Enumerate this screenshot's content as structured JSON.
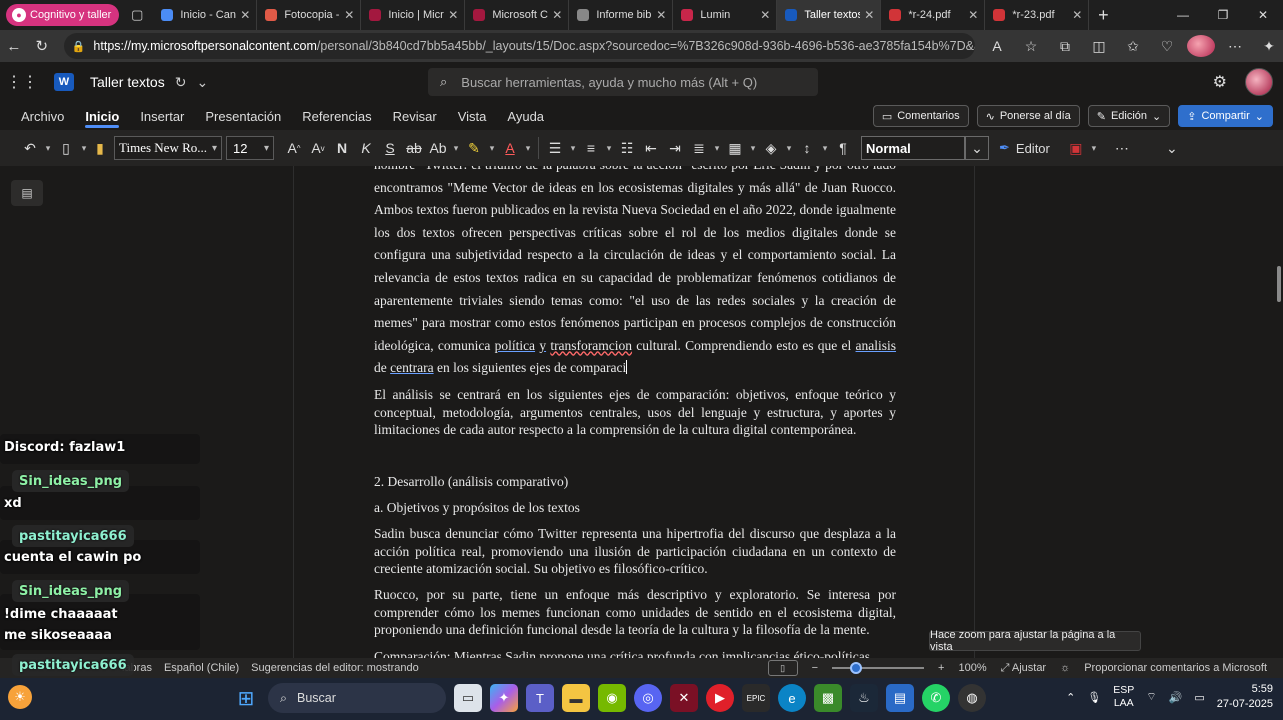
{
  "browser": {
    "profile_label": "Cognitivo y taller",
    "tabs": [
      {
        "title": "Inicio - Canv",
        "color": "#4b8cf5"
      },
      {
        "title": "Fotocopia -",
        "color": "#e05a47"
      },
      {
        "title": "Inicio | Micr",
        "color": "#a3183f"
      },
      {
        "title": "Microsoft C",
        "color": "#a3183f"
      },
      {
        "title": "Informe bibl",
        "color": "#888888"
      },
      {
        "title": "Lumin",
        "color": "#c8264a"
      },
      {
        "title": "Taller textos",
        "color": "#185abd"
      },
      {
        "title": "*r-24.pdf",
        "color": "#d13438"
      },
      {
        "title": "*r-23.pdf",
        "color": "#d13438"
      }
    ],
    "url_host": "https://my.microsoftpersonalcontent.com",
    "url_path": "/personal/3b840cd7bb5a45bb/_layouts/15/Doc.aspx?sourcedoc=%7B326c908d-936b-4696-b536-ae3785fa154b%7D&action=default"
  },
  "word": {
    "doc_title": "Taller textos",
    "search_placeholder": "Buscar herramientas, ayuda y mucho más (Alt + Q)",
    "ribbon_tabs": [
      "Archivo",
      "Inicio",
      "Insertar",
      "Presentación",
      "Referencias",
      "Revisar",
      "Vista",
      "Ayuda"
    ],
    "buttons": {
      "comments": "Comentarios",
      "catchup": "Ponerse al día",
      "editing": "Edición",
      "share": "Compartir"
    },
    "toolbar": {
      "font": "Times New Ro...",
      "size": "12",
      "style": "Normal",
      "editor": "Editor"
    }
  },
  "document": {
    "p1_a": "hombre \"Twitter: el triunfo de la palabra sobre la acción\" escrito por Eric Sadin y por otro lado encontramos \"Meme Vector de ideas en los ecosistemas digitales y más allá\" de Juan Ruocco. Ambos textos fueron publicados en la revista Nueva Sociedad en el año 2022, donde igualmente los dos textos ofrecen perspectivas críticas sobre el rol de los medios digitales donde se configura una subjetividad respecto a la circulación de ideas y el comportamiento social. La relevancia de estos textos radica en su capacidad de problematizar fenómenos cotidianos de aparentemente triviales siendo temas como: \"el uso de las redes sociales y la creación de memes\" para mostrar como estos fenómenos participan en procesos complejos de construcción ideológica, comunica ",
    "p1_u1": "política",
    "p1_sp": " ",
    "p1_u2": "y",
    "p1_sp2": " ",
    "p1_u3": "transforamcion",
    "p1_b": " cultural. Comprendiendo esto es que el ",
    "p1_u4": "analisis",
    "p1_c": " de ",
    "p1_u5": "centrara",
    "p1_d": " en los siguientes ejes de comparaci",
    "p2": "El análisis se centrará en los siguientes ejes de comparación: objetivos, enfoque teórico y conceptual, metodología, argumentos centrales, usos del lenguaje y estructura, y aportes y limitaciones de cada autor respecto a la comprensión de la cultura digital contemporánea.",
    "h1": "2. Desarrollo (análisis comparativo)",
    "h2": "a. Objetivos y propósitos de los textos",
    "p3": "Sadin busca denunciar cómo Twitter representa una hipertrofia del discurso que desplaza a la acción política real, promoviendo una ilusión de participación ciudadana en un contexto de creciente atomización social. Su objetivo es filosófico-crítico.",
    "p4": "Ruocco, por su parte, tiene un enfoque más descriptivo y exploratorio. Se interesa por comprender cómo los memes funcionan como unidades de sentido en el ecosistema digital, proponiendo una definición funcional desde la teoría de la cultura y la filosofía de la mente.",
    "p5": "Comparación: Mientras Sadin propone una crítica profunda con implicancias ético-políticas"
  },
  "tooltip": "Hace zoom para ajustar la página a la vista",
  "status": {
    "words": "labras",
    "language": "Español (Chile)",
    "editor_suggestions": "Sugerencias del editor: mostrando",
    "zoom": "100%",
    "fit": "Ajustar",
    "feedback": "Proporcionar comentarios a Microsoft"
  },
  "chat": {
    "discord": "Discord: fazlaw1",
    "messages": [
      {
        "user": "Sin_ideas_png",
        "user_color": "#8ef0a6",
        "text": "xd"
      },
      {
        "user": "pastitayica666",
        "user_color": "#8ef0d0",
        "text": "cuenta el cawin po"
      },
      {
        "user": "Sin_ideas_png",
        "user_color": "#8ef0a6",
        "text": "!dime chaaaaat me sikoseaaaa"
      },
      {
        "user": "pastitayica666",
        "user_color": "#8ef0d0",
        "text": ""
      }
    ]
  },
  "taskbar": {
    "search": "Buscar",
    "lang_top": "ESP",
    "lang_bottom": "LAA",
    "time": "5:59",
    "date": "27-07-2025"
  }
}
